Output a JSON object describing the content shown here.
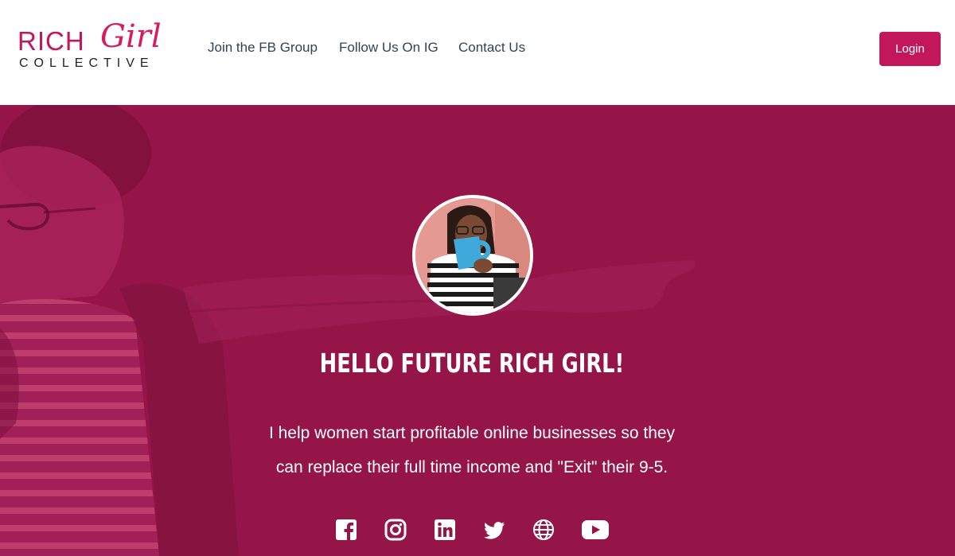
{
  "brand": {
    "logo_rich": "RICH",
    "logo_girl": "Girl",
    "logo_collective": "COLLECTIVE",
    "primary_color": "#c2185b",
    "hero_color": "#961548"
  },
  "nav": {
    "items": [
      {
        "label": "Join the FB Group"
      },
      {
        "label": "Follow Us On IG"
      },
      {
        "label": "Contact Us"
      }
    ],
    "login_label": "Login"
  },
  "hero": {
    "title": "HELLO FUTURE RICH GIRL!",
    "line1": "I help women start profitable online businesses so they",
    "line2": "can replace their full time income and \"Exit\" their 9-5."
  },
  "socials": [
    {
      "icon": "facebook-icon"
    },
    {
      "icon": "instagram-icon"
    },
    {
      "icon": "linkedin-icon"
    },
    {
      "icon": "twitter-icon"
    },
    {
      "icon": "globe-icon"
    },
    {
      "icon": "youtube-icon"
    }
  ]
}
